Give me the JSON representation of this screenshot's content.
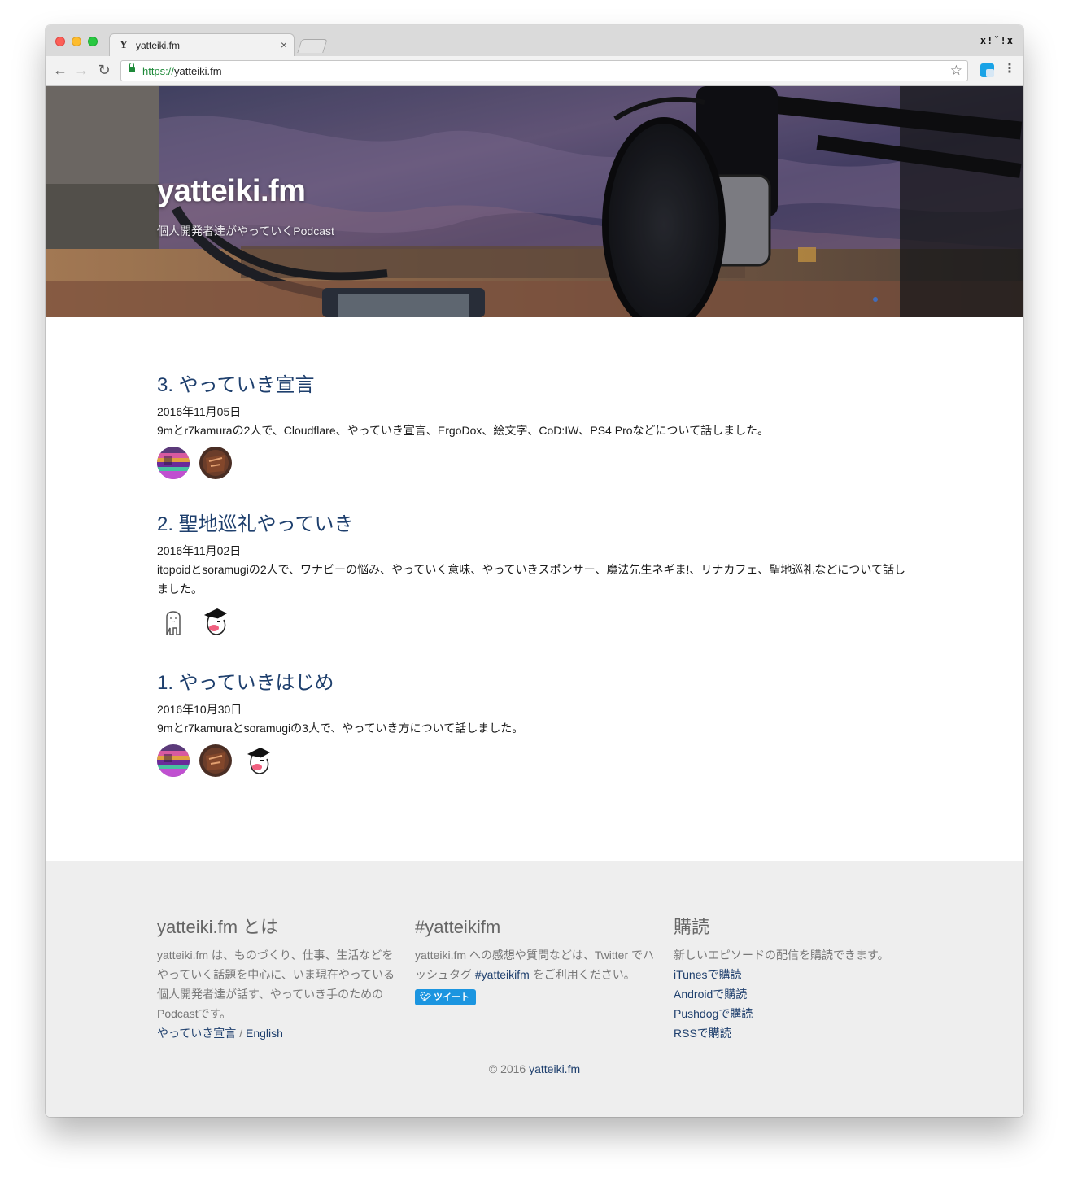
{
  "browser": {
    "tab_title": "yatteiki.fm",
    "tab_favicon": "Y",
    "tab_close": "×",
    "url_scheme": "https://",
    "url_host": "yatteiki.fm",
    "profile_mark": "x!ˇ!x",
    "icons": {
      "back": "←",
      "forward": "→",
      "reload": "↻",
      "star": "☆",
      "menu": "⋮"
    }
  },
  "hero": {
    "title": "yatteiki.fm",
    "subtitle": "個人開発者達がやっていくPodcast"
  },
  "episodes": [
    {
      "title": "3. やっていき宣言",
      "date": "2016年11月05日",
      "description": "9mとr7kamuraの2人で、Cloudflare、やっていき宣言、ErgoDox、絵文字、CoD:IW、PS4 Proなどについて話しました。",
      "avatars": [
        "9m",
        "r7kamura"
      ]
    },
    {
      "title": "2. 聖地巡礼やっていき",
      "date": "2016年11月02日",
      "description": "itopoidとsoramugiの2人で、ワナビーの悩み、やっていく意味、やっていきスポンサー、魔法先生ネギま!、リナカフェ、聖地巡礼などについて話しました。",
      "avatars": [
        "itopoid",
        "soramugi"
      ]
    },
    {
      "title": "1. やっていきはじめ",
      "date": "2016年10月30日",
      "description": "9mとr7kamuraとsoramugiの3人で、やっていき方について話しました。",
      "avatars": [
        "9m",
        "r7kamura",
        "soramugi"
      ]
    }
  ],
  "footer": {
    "about": {
      "heading": "yatteiki.fm とは",
      "text": "yatteiki.fm は、ものづくり、仕事、生活などをやっていく話題を中心に、いま現在やっている個人開発者達が話す、やっていき手のためのPodcastです。",
      "link_manifesto": "やっていき宣言",
      "separator": " / ",
      "link_english": "English"
    },
    "hashtag": {
      "heading": "#yatteikifm",
      "text_before": "yatteiki.fm への感想や質問などは、Twitter でハッシュタグ ",
      "hashtag_link": "#yatteikifm",
      "text_after": " をご利用ください。",
      "tweet_button": "ツイート"
    },
    "subscribe": {
      "heading": "購読",
      "text": "新しいエピソードの配信を購読できます。",
      "links": [
        "iTunesで購読",
        "Androidで購読",
        "Pushdogで購読",
        "RSSで購読"
      ]
    },
    "copyright_prefix": "© 2016 ",
    "copyright_link": "yatteiki.fm"
  }
}
